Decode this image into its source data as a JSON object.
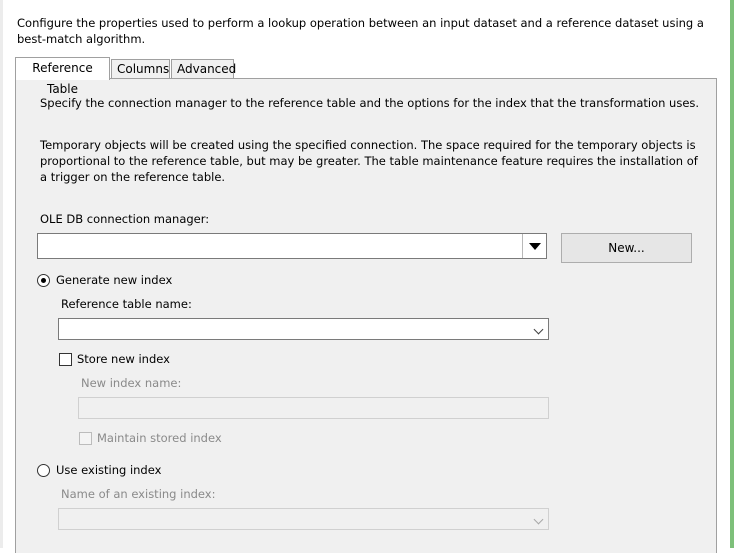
{
  "description": "Configure the properties used to perform a lookup operation between an input dataset and a reference dataset using a best-match algorithm.",
  "tabs": [
    {
      "label": "Reference Table",
      "active": true
    },
    {
      "label": "Columns",
      "active": false
    },
    {
      "label": "Advanced",
      "active": false
    }
  ],
  "panel": {
    "intro": "Specify the connection manager to the reference table and the options for the index that the transformation uses.",
    "temp_note": "Temporary objects will be created using the specified connection. The space required for the temporary objects is proportional to the reference table, but may be greater. The table maintenance feature requires the installation of a trigger on the reference table.",
    "connection_label": "OLE DB connection manager:",
    "connection_value": "",
    "new_button": "New...",
    "generate_index_label": "Generate new index",
    "generate_index_selected": true,
    "reference_table_label": "Reference table name:",
    "reference_table_value": "",
    "store_index_label": "Store new index",
    "store_index_checked": false,
    "new_index_name_label": "New index name:",
    "new_index_name_value": "",
    "maintain_index_label": "Maintain stored index",
    "use_existing_label": "Use existing index",
    "use_existing_selected": false,
    "existing_index_label": "Name of an existing index:",
    "existing_index_value": ""
  },
  "icons": {
    "dropdown": "triangle-down-icon",
    "chevron": "chevron-down-icon"
  }
}
